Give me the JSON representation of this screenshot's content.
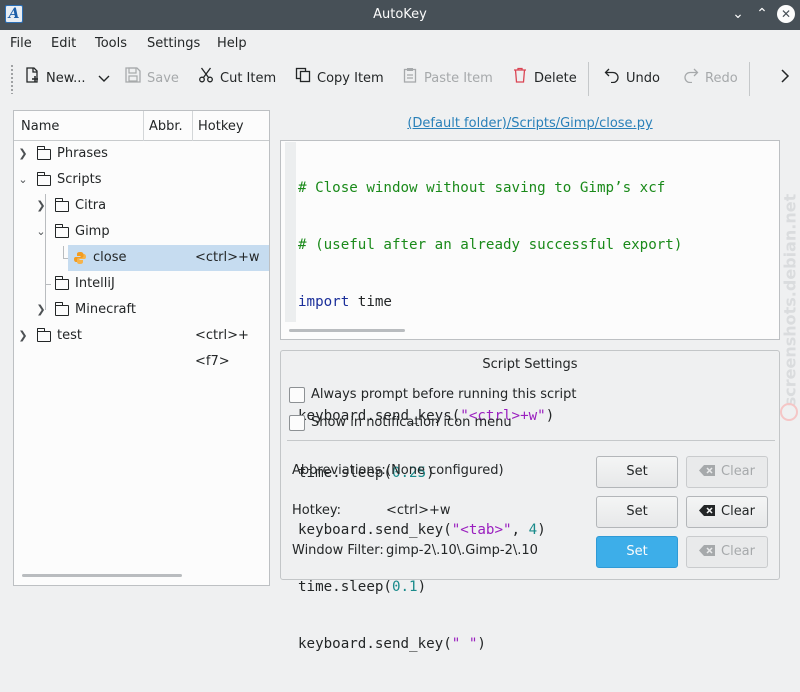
{
  "window": {
    "title": "AutoKey"
  },
  "menu": [
    "File",
    "Edit",
    "Tools",
    "Settings",
    "Help"
  ],
  "toolbar": {
    "new": "New...",
    "save": "Save",
    "cut": "Cut Item",
    "copy": "Copy Item",
    "paste": "Paste Item",
    "delete": "Delete",
    "undo": "Undo",
    "redo": "Redo"
  },
  "tree": {
    "columns": {
      "name": "Name",
      "abbr": "Abbr.",
      "hotkey": "Hotkey"
    },
    "rows": [
      {
        "label": "Phrases",
        "hotkey": ""
      },
      {
        "label": "Scripts",
        "hotkey": ""
      },
      {
        "label": "Citra",
        "hotkey": ""
      },
      {
        "label": "Gimp",
        "hotkey": ""
      },
      {
        "label": "close",
        "hotkey": "<ctrl>+w"
      },
      {
        "label": "IntelliJ",
        "hotkey": ""
      },
      {
        "label": "Minecraft",
        "hotkey": ""
      },
      {
        "label": "test",
        "hotkey": "<ctrl>+<f7>"
      }
    ]
  },
  "script_path": "(Default folder)/Scripts/Gimp/close.py",
  "code": {
    "l1": "# Close window without saving to Gimp’s xcf",
    "l2": "# (useful after an already successful export)",
    "l3_kw": "import",
    "l3_rest": " time",
    "l5_a": "keyboard.send_keys(",
    "l5_s": "\"<ctrl>+w\"",
    "l5_b": ")",
    "l6_a": "time.sleep(",
    "l6_n": "0.25",
    "l6_b": ")",
    "l7_a": "keyboard.send_key(",
    "l7_s": "\"<tab>\"",
    "l7_m": ", ",
    "l7_n": "4",
    "l7_b": ")",
    "l8_a": "time.sleep(",
    "l8_n": "0.1",
    "l8_b": ")",
    "l9_a": "keyboard.send_key(",
    "l9_s": "\" \"",
    "l9_b": ")"
  },
  "settings": {
    "title": "Script Settings",
    "always_prompt": "Always prompt before running this script",
    "show_notification": "Show in notification icon menu",
    "abbreviations_label": "Abbreviations:",
    "abbreviations_value": "(None configured)",
    "hotkey_label": "Hotkey:",
    "hotkey_value": "<ctrl>+w",
    "window_filter_label": "Window Filter:",
    "window_filter_value": "gimp-2\\.10\\.Gimp-2\\.10",
    "set": "Set",
    "clear": "Clear"
  },
  "watermark": "screenshots.debian.net",
  "colors": {
    "accent": "#3daee9",
    "titlebar": "#475057",
    "selection": "#c6dcf0",
    "link": "#2980b9"
  }
}
